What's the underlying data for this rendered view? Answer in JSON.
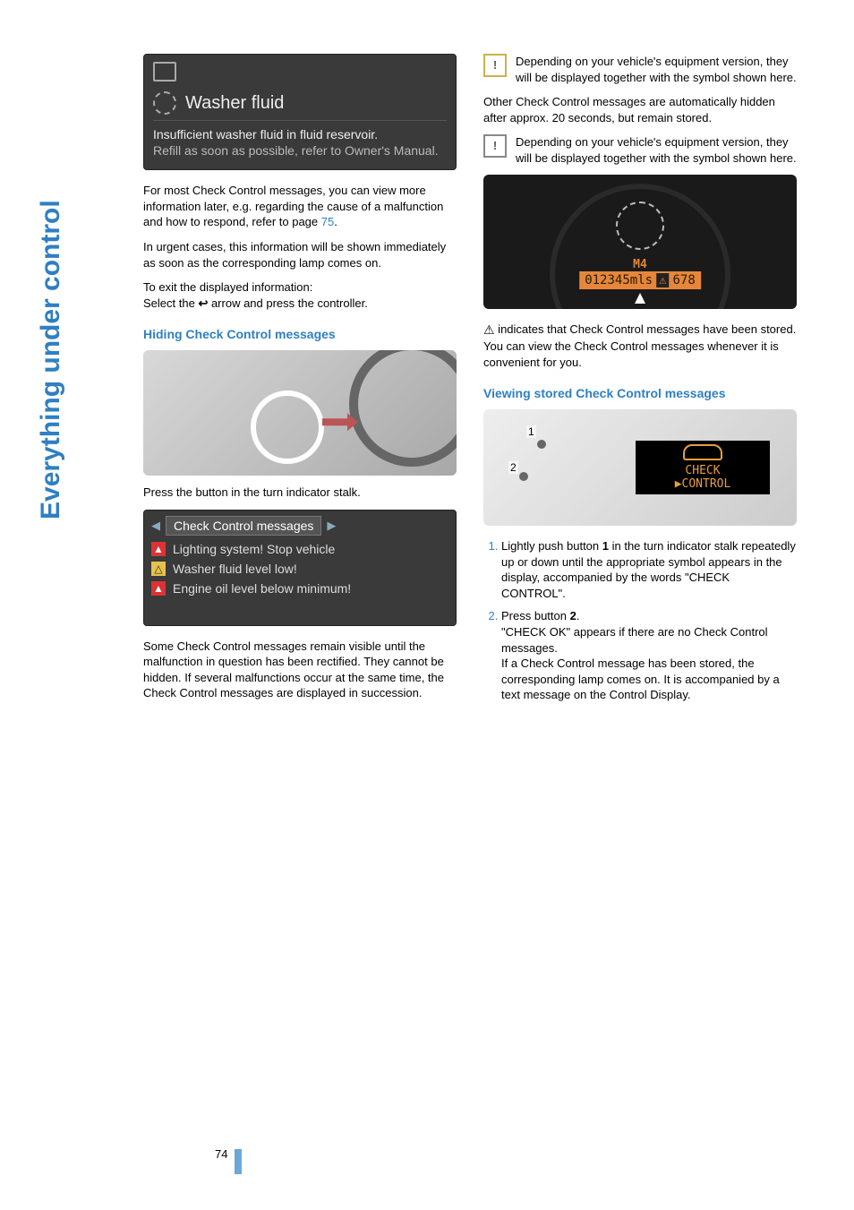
{
  "side_title": "Everything under control",
  "page_number": "74",
  "left": {
    "washer_screenshot": {
      "title": "Washer fluid",
      "line1": "Insufficient washer fluid in fluid reservoir.",
      "line2": "Refill as soon as possible, refer to Owner's Manual."
    },
    "p1a": "For most Check Control messages, you can view more information later, e.g. regarding the cause of a malfunction and how to respond, refer to page ",
    "p1_link": "75",
    "p1b": ".",
    "p2": "In urgent cases, this information will be shown immediately as soon as the corresponding lamp comes on.",
    "p3a": "To exit the displayed information:",
    "p3b_a": "Select the ",
    "p3b_b": " arrow and press the controller.",
    "heading1": "Hiding Check Control messages",
    "p4": "Press the button in the turn indicator stalk.",
    "cc_screenshot": {
      "tab": "Check Control messages",
      "row1": "Lighting system! Stop vehicle",
      "row2": "Washer fluid level low!",
      "row3": "Engine oil level below minimum!"
    },
    "p5": "Some Check Control messages remain visible until the malfunction in question has been rectified. They cannot be hidden. If several malfunctions occur at the same time, the Check Control messages are displayed in succession."
  },
  "right": {
    "p1": "Depending on your vehicle's equipment version, they will be displayed together with the symbol shown here.",
    "p2": "Other Check Control messages are automatically hidden after approx. 20 seconds, but remain stored.",
    "p3": "Depending on your vehicle's equipment version, they will be displayed together with the symbol shown here.",
    "tach": {
      "m_label": "M4",
      "odo": "012345mls",
      "warn": "⚠",
      "seg": "678"
    },
    "p4": " indicates that Check Control messages have been stored. You can view the Check Control messages whenever it is convenient for you.",
    "heading2": "Viewing stored Check Control messages",
    "cluster": {
      "label1": "1",
      "label2": "2",
      "lcd_line1": "CHECK",
      "lcd_line2": "▶CONTROL"
    },
    "steps": {
      "s1_a": "Lightly push button ",
      "s1_bold": "1",
      "s1_b": " in the turn indicator stalk repeatedly up or down until the appropriate symbol appears in the display, accompanied by the words \"CHECK CONTROL\".",
      "s2_a": "Press button ",
      "s2_bold": "2",
      "s2_b": ".",
      "s2_c": "\"CHECK OK\" appears if there are no Check Control messages.",
      "s2_d": "If a Check Control message has been stored, the corresponding lamp comes on. It is accompanied by a text message on the Control Display."
    }
  }
}
